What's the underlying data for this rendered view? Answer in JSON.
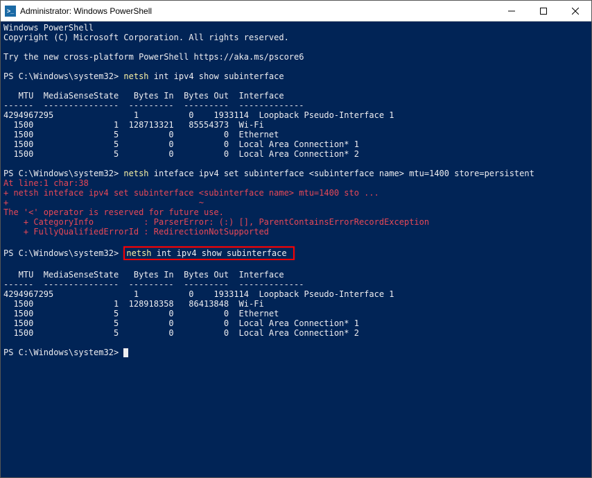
{
  "titlebar": {
    "icon_label": ">_",
    "title": "Administrator: Windows PowerShell"
  },
  "header_lines": [
    "Windows PowerShell",
    "Copyright (C) Microsoft Corporation. All rights reserved.",
    "",
    "Try the new cross-platform PowerShell https://aka.ms/pscore6",
    ""
  ],
  "prompt": "PS C:\\Windows\\system32>",
  "cmd1_a": "netsh",
  "cmd1_b": " int ipv4 show subinterface",
  "table_header": "   MTU  MediaSenseState   Bytes In  Bytes Out  Interface",
  "table_sep": "------  ---------------  ---------  ---------  -------------",
  "table1_rows": [
    "4294967295                1          0    1933114  Loopback Pseudo-Interface 1",
    "  1500                1  128713321   85554373  Wi-Fi",
    "  1500                5          0          0  Ethernet",
    "  1500                5          0          0  Local Area Connection* 1",
    "  1500                5          0          0  Local Area Connection* 2"
  ],
  "cmd2_a": "netsh",
  "cmd2_b": " inteface ipv4 set subinterface <subinterface name> mtu=1400 store=persistent",
  "error": {
    "l1": "At line:1 char:38",
    "l2": "+ netsh inteface ipv4 set subinterface <subinterface name> mtu=1400 sto ...",
    "l3": "+                                      ~",
    "l4": "The '<' operator is reserved for future use.",
    "l5": "    + CategoryInfo          : ParserError: (:) [], ParentContainsErrorRecordException",
    "l6": "    + FullyQualifiedErrorId : RedirectionNotSupported"
  },
  "cmd3": "netsh int ipv4 show subinterface",
  "table2_rows": [
    "4294967295                1          0    1933114  Loopback Pseudo-Interface 1",
    "  1500                1  128918358   86413848  Wi-Fi",
    "  1500                5          0          0  Ethernet",
    "  1500                5          0          0  Local Area Connection* 1",
    "  1500                5          0          0  Local Area Connection* 2"
  ]
}
